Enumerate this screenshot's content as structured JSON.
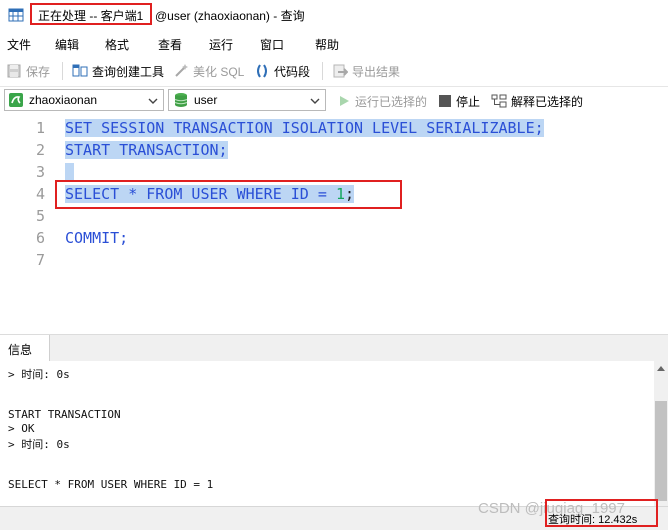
{
  "titlebar": {
    "status": "正在处理 -- 客户端1",
    "rest": "@user (zhaoxiaonan) - 查询"
  },
  "menu": [
    "文件",
    "编辑",
    "格式",
    "查看",
    "运行",
    "窗口",
    "帮助"
  ],
  "toolbar": {
    "save": "保存",
    "query_builder": "查询创建工具",
    "beautify": "美化 SQL",
    "snippet": "代码段",
    "export": "导出结果"
  },
  "connection": {
    "server": "zhaoxiaonan",
    "database": "user",
    "run_selected": "运行已选择的",
    "stop": "停止",
    "explain_selected": "解释已选择的"
  },
  "editor": {
    "line_numbers": [
      "1",
      "2",
      "3",
      "4",
      "5",
      "6",
      "7"
    ],
    "lines": {
      "l1": "SET SESSION TRANSACTION ISOLATION LEVEL SERIALIZABLE;",
      "l2": "START TRANSACTION;",
      "l4a": "SELECT * FROM USER WHERE ID = ",
      "l4b": "1",
      "l4c": ";",
      "l6": "COMMIT;"
    }
  },
  "info_panel": {
    "tab": "信息",
    "log": [
      "> 时间: 0s",
      "",
      "",
      "START TRANSACTION",
      "> OK",
      "> 时间: 0s",
      "",
      "",
      "SELECT * FROM USER WHERE ID = 1"
    ]
  },
  "status": {
    "query_time": "查询时间: 12.432s",
    "watermark": "CSDN @jiugiag_1997"
  },
  "colors": {
    "selection": "#bcd6f4",
    "keyword": "#2a4fd6",
    "highlight_box": "#e02020"
  }
}
